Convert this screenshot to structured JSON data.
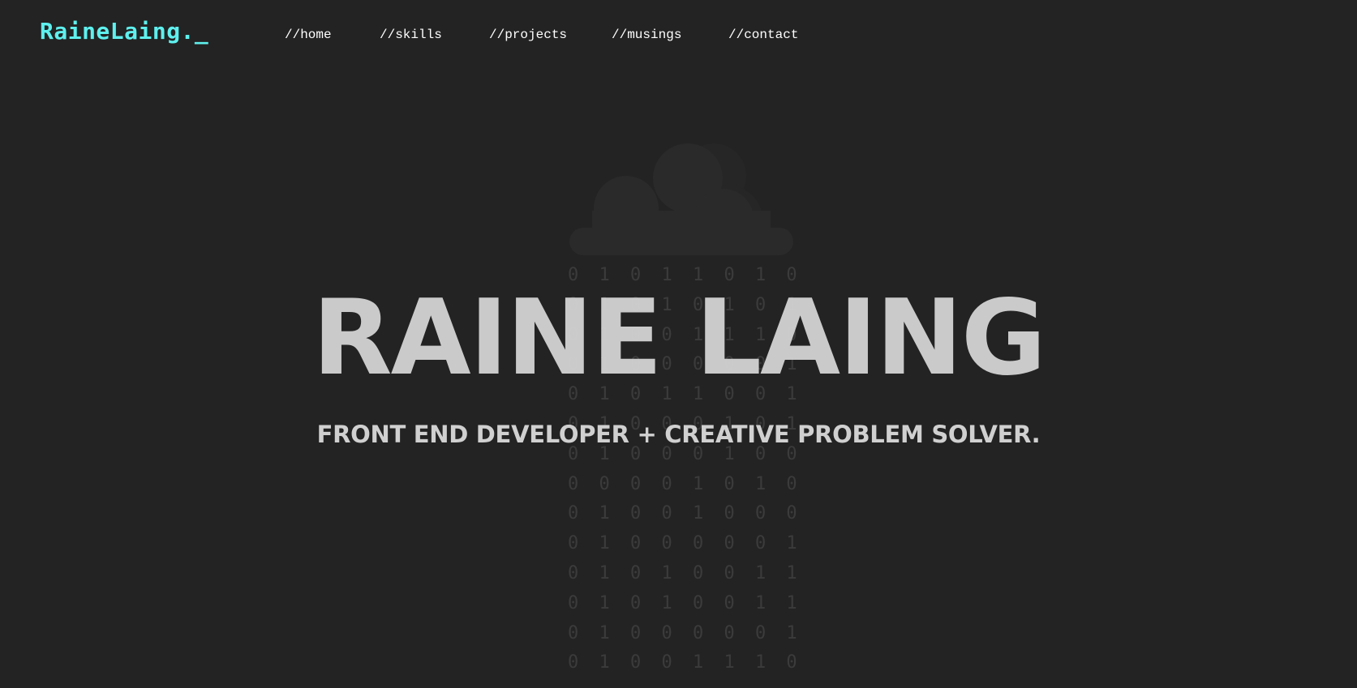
{
  "header": {
    "logo": "RaineLaing._",
    "nav": [
      {
        "label": "//home"
      },
      {
        "label": "//skills"
      },
      {
        "label": "//projects"
      },
      {
        "label": "//musings"
      },
      {
        "label": "//contact"
      }
    ]
  },
  "hero": {
    "title": "RAINE LAING",
    "subtitle": "FRONT END DEVELOPER + CREATIVE PROBLEM SOLVER.",
    "binary_rain": [
      "0 1 0 1 1 0 1 0",
      "0 1 0 1 0 1 0 1",
      "0 1 0 0 1 1 1 0",
      "0 1 0 0 0 0 0 1",
      "0 1 0 1 1 0 0 1",
      "0 1 0 0 0 1 0 1",
      "0 1 0 0 0 1 0 0",
      "0 0 0 0 1 0 1 0",
      "0 1 0 0 1 0 0 0",
      "0 1 0 0 0 0 0 1",
      "0 1 0 1 0 0 1 1",
      "0 1 0 1 0 0 1 1",
      "0 1 0 0 0 0 0 1",
      "0 1 0 0 1 1 1 0"
    ]
  },
  "colors": {
    "background": "#232323",
    "logo": "#5ef0ee",
    "nav_text": "#ffffff",
    "hero_text": "#d0d0d0",
    "cloud": "#2b2b2b",
    "binary": "#3b3b3b"
  },
  "icons": {
    "cloud": "cloud-icon"
  }
}
